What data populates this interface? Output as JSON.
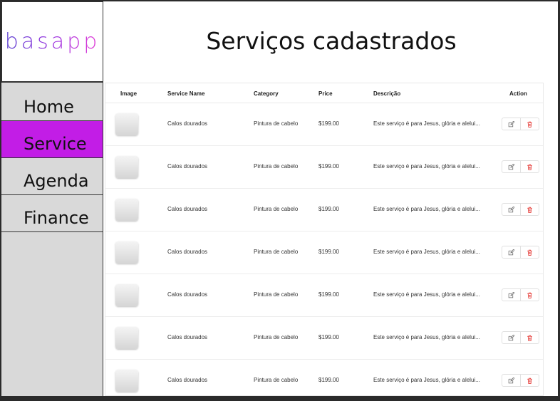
{
  "app": {
    "logo_text": "basapp"
  },
  "nav": {
    "items": [
      {
        "label": "Home",
        "active": false
      },
      {
        "label": "Service",
        "active": true
      },
      {
        "label": "Agenda",
        "active": false
      },
      {
        "label": "Finance",
        "active": false
      }
    ]
  },
  "page": {
    "title": "Serviços cadastrados"
  },
  "table": {
    "headers": {
      "image": "Image",
      "service_name": "Service Name",
      "category": "Category",
      "price": "Price",
      "description": "Descrição",
      "action": "Action"
    },
    "rows": [
      {
        "name": "Calos dourados",
        "category": "Pintura de cabelo",
        "price": "$199.00",
        "description": "Este serviço é para Jesus, glória e alelui..."
      },
      {
        "name": "Calos dourados",
        "category": "Pintura de cabelo",
        "price": "$199.00",
        "description": "Este serviço é para Jesus, glória e alelui..."
      },
      {
        "name": "Calos dourados",
        "category": "Pintura de cabelo",
        "price": "$199.00",
        "description": "Este serviço é para Jesus, glória e alelui..."
      },
      {
        "name": "Calos dourados",
        "category": "Pintura de cabelo",
        "price": "$199.00",
        "description": "Este serviço é para Jesus, glória e alelui..."
      },
      {
        "name": "Calos dourados",
        "category": "Pintura de cabelo",
        "price": "$199.00",
        "description": "Este serviço é para Jesus, glória e alelui..."
      },
      {
        "name": "Calos dourados",
        "category": "Pintura de cabelo",
        "price": "$199.00",
        "description": "Este serviço é para Jesus, glória e alelui..."
      },
      {
        "name": "Calos dourados",
        "category": "Pintura de cabelo",
        "price": "$199.00",
        "description": "Este serviço é para Jesus, glória e alelui..."
      }
    ],
    "action_icons": {
      "edit": "edit-icon",
      "delete": "trash-icon"
    }
  },
  "colors": {
    "active_nav": "#c21de6",
    "sidebar_bg": "#d9d9d9",
    "delete_icon": "#e53935",
    "edit_icon": "#666666"
  }
}
